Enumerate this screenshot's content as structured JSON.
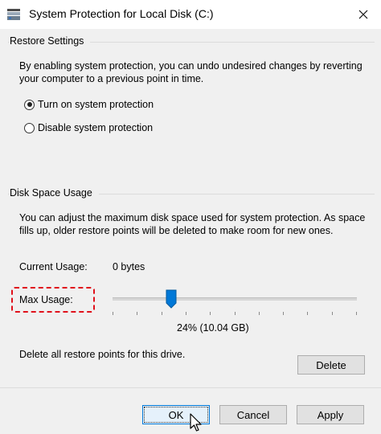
{
  "window": {
    "title": "System Protection for Local Disk (C:)"
  },
  "restore_settings": {
    "group_title": "Restore Settings",
    "description": "By enabling system protection, you can undo undesired changes by reverting your computer to a previous point in time.",
    "options": [
      {
        "label": "Turn on system protection",
        "selected": true
      },
      {
        "label": "Disable system protection",
        "selected": false
      }
    ]
  },
  "disk_space": {
    "group_title": "Disk Space Usage",
    "description": "You can adjust the maximum disk space used for system protection. As space fills up, older restore points will be deleted to make room for new ones.",
    "current_usage_label": "Current Usage:",
    "current_usage_value": "0 bytes",
    "max_usage_label": "Max Usage:",
    "max_usage_percent": 24,
    "max_usage_value": "24% (10.04 GB)",
    "delete_text": "Delete all restore points for this drive.",
    "delete_label": "Delete"
  },
  "buttons": {
    "ok": "OK",
    "cancel": "Cancel",
    "apply": "Apply"
  },
  "colors": {
    "highlight_box": "#e0111b",
    "slider_thumb": "#0078d7",
    "default_button_border": "#0078d7"
  }
}
